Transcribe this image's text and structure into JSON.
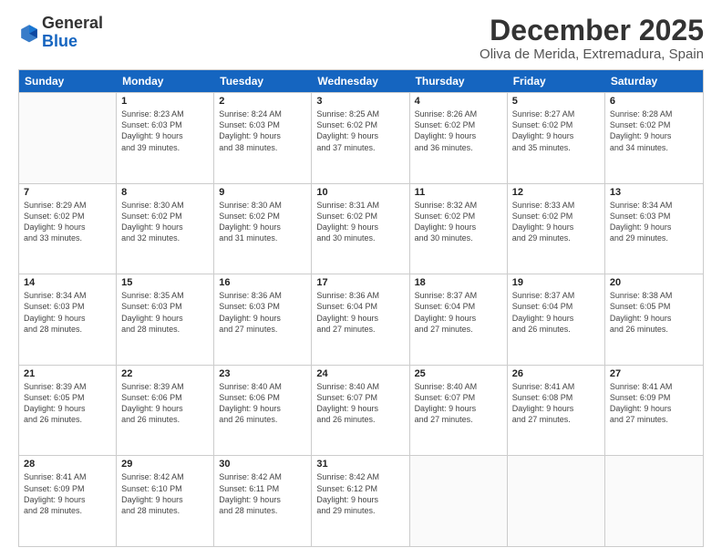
{
  "logo": {
    "general": "General",
    "blue": "Blue"
  },
  "header": {
    "month": "December 2025",
    "location": "Oliva de Merida, Extremadura, Spain"
  },
  "days": [
    "Sunday",
    "Monday",
    "Tuesday",
    "Wednesday",
    "Thursday",
    "Friday",
    "Saturday"
  ],
  "weeks": [
    [
      {
        "day": "",
        "sunrise": "",
        "sunset": "",
        "daylight": ""
      },
      {
        "day": "1",
        "sunrise": "Sunrise: 8:23 AM",
        "sunset": "Sunset: 6:03 PM",
        "daylight": "Daylight: 9 hours and 39 minutes."
      },
      {
        "day": "2",
        "sunrise": "Sunrise: 8:24 AM",
        "sunset": "Sunset: 6:03 PM",
        "daylight": "Daylight: 9 hours and 38 minutes."
      },
      {
        "day": "3",
        "sunrise": "Sunrise: 8:25 AM",
        "sunset": "Sunset: 6:02 PM",
        "daylight": "Daylight: 9 hours and 37 minutes."
      },
      {
        "day": "4",
        "sunrise": "Sunrise: 8:26 AM",
        "sunset": "Sunset: 6:02 PM",
        "daylight": "Daylight: 9 hours and 36 minutes."
      },
      {
        "day": "5",
        "sunrise": "Sunrise: 8:27 AM",
        "sunset": "Sunset: 6:02 PM",
        "daylight": "Daylight: 9 hours and 35 minutes."
      },
      {
        "day": "6",
        "sunrise": "Sunrise: 8:28 AM",
        "sunset": "Sunset: 6:02 PM",
        "daylight": "Daylight: 9 hours and 34 minutes."
      }
    ],
    [
      {
        "day": "7",
        "sunrise": "Sunrise: 8:29 AM",
        "sunset": "Sunset: 6:02 PM",
        "daylight": "Daylight: 9 hours and 33 minutes."
      },
      {
        "day": "8",
        "sunrise": "Sunrise: 8:30 AM",
        "sunset": "Sunset: 6:02 PM",
        "daylight": "Daylight: 9 hours and 32 minutes."
      },
      {
        "day": "9",
        "sunrise": "Sunrise: 8:30 AM",
        "sunset": "Sunset: 6:02 PM",
        "daylight": "Daylight: 9 hours and 31 minutes."
      },
      {
        "day": "10",
        "sunrise": "Sunrise: 8:31 AM",
        "sunset": "Sunset: 6:02 PM",
        "daylight": "Daylight: 9 hours and 30 minutes."
      },
      {
        "day": "11",
        "sunrise": "Sunrise: 8:32 AM",
        "sunset": "Sunset: 6:02 PM",
        "daylight": "Daylight: 9 hours and 30 minutes."
      },
      {
        "day": "12",
        "sunrise": "Sunrise: 8:33 AM",
        "sunset": "Sunset: 6:02 PM",
        "daylight": "Daylight: 9 hours and 29 minutes."
      },
      {
        "day": "13",
        "sunrise": "Sunrise: 8:34 AM",
        "sunset": "Sunset: 6:03 PM",
        "daylight": "Daylight: 9 hours and 29 minutes."
      }
    ],
    [
      {
        "day": "14",
        "sunrise": "Sunrise: 8:34 AM",
        "sunset": "Sunset: 6:03 PM",
        "daylight": "Daylight: 9 hours and 28 minutes."
      },
      {
        "day": "15",
        "sunrise": "Sunrise: 8:35 AM",
        "sunset": "Sunset: 6:03 PM",
        "daylight": "Daylight: 9 hours and 28 minutes."
      },
      {
        "day": "16",
        "sunrise": "Sunrise: 8:36 AM",
        "sunset": "Sunset: 6:03 PM",
        "daylight": "Daylight: 9 hours and 27 minutes."
      },
      {
        "day": "17",
        "sunrise": "Sunrise: 8:36 AM",
        "sunset": "Sunset: 6:04 PM",
        "daylight": "Daylight: 9 hours and 27 minutes."
      },
      {
        "day": "18",
        "sunrise": "Sunrise: 8:37 AM",
        "sunset": "Sunset: 6:04 PM",
        "daylight": "Daylight: 9 hours and 27 minutes."
      },
      {
        "day": "19",
        "sunrise": "Sunrise: 8:37 AM",
        "sunset": "Sunset: 6:04 PM",
        "daylight": "Daylight: 9 hours and 26 minutes."
      },
      {
        "day": "20",
        "sunrise": "Sunrise: 8:38 AM",
        "sunset": "Sunset: 6:05 PM",
        "daylight": "Daylight: 9 hours and 26 minutes."
      }
    ],
    [
      {
        "day": "21",
        "sunrise": "Sunrise: 8:39 AM",
        "sunset": "Sunset: 6:05 PM",
        "daylight": "Daylight: 9 hours and 26 minutes."
      },
      {
        "day": "22",
        "sunrise": "Sunrise: 8:39 AM",
        "sunset": "Sunset: 6:06 PM",
        "daylight": "Daylight: 9 hours and 26 minutes."
      },
      {
        "day": "23",
        "sunrise": "Sunrise: 8:40 AM",
        "sunset": "Sunset: 6:06 PM",
        "daylight": "Daylight: 9 hours and 26 minutes."
      },
      {
        "day": "24",
        "sunrise": "Sunrise: 8:40 AM",
        "sunset": "Sunset: 6:07 PM",
        "daylight": "Daylight: 9 hours and 26 minutes."
      },
      {
        "day": "25",
        "sunrise": "Sunrise: 8:40 AM",
        "sunset": "Sunset: 6:07 PM",
        "daylight": "Daylight: 9 hours and 27 minutes."
      },
      {
        "day": "26",
        "sunrise": "Sunrise: 8:41 AM",
        "sunset": "Sunset: 6:08 PM",
        "daylight": "Daylight: 9 hours and 27 minutes."
      },
      {
        "day": "27",
        "sunrise": "Sunrise: 8:41 AM",
        "sunset": "Sunset: 6:09 PM",
        "daylight": "Daylight: 9 hours and 27 minutes."
      }
    ],
    [
      {
        "day": "28",
        "sunrise": "Sunrise: 8:41 AM",
        "sunset": "Sunset: 6:09 PM",
        "daylight": "Daylight: 9 hours and 28 minutes."
      },
      {
        "day": "29",
        "sunrise": "Sunrise: 8:42 AM",
        "sunset": "Sunset: 6:10 PM",
        "daylight": "Daylight: 9 hours and 28 minutes."
      },
      {
        "day": "30",
        "sunrise": "Sunrise: 8:42 AM",
        "sunset": "Sunset: 6:11 PM",
        "daylight": "Daylight: 9 hours and 28 minutes."
      },
      {
        "day": "31",
        "sunrise": "Sunrise: 8:42 AM",
        "sunset": "Sunset: 6:12 PM",
        "daylight": "Daylight: 9 hours and 29 minutes."
      },
      {
        "day": "",
        "sunrise": "",
        "sunset": "",
        "daylight": ""
      },
      {
        "day": "",
        "sunrise": "",
        "sunset": "",
        "daylight": ""
      },
      {
        "day": "",
        "sunrise": "",
        "sunset": "",
        "daylight": ""
      }
    ]
  ]
}
